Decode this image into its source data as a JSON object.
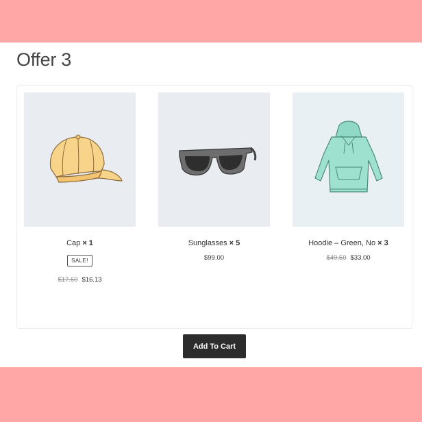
{
  "colors": {
    "band": "#ffa7a7",
    "panel": "#ffffff",
    "button": "#2c2c2c"
  },
  "offer": {
    "title": "Offer 3"
  },
  "products": [
    {
      "name": "Cap",
      "qty": "× 1",
      "badge": "SALE!",
      "old_price": "$17.60",
      "price": "$16.13",
      "icon": "cap-image"
    },
    {
      "name": "Sunglasses",
      "qty": "× 5",
      "price": "$99.00",
      "icon": "sunglasses-image"
    },
    {
      "name": "Hoodie – Green, No",
      "qty": "× 3",
      "old_price": "$49.50",
      "price": "$33.00",
      "icon": "hoodie-image"
    }
  ],
  "cart": {
    "button_label": "Add To Cart"
  }
}
